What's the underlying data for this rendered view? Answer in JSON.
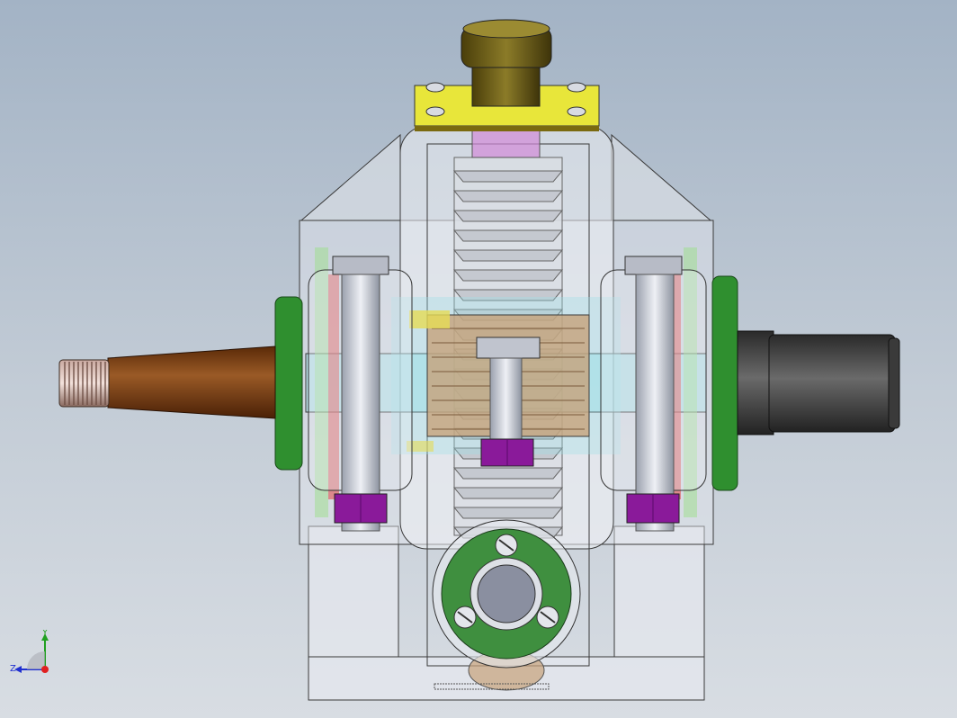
{
  "viewport": {
    "background_top": "#a3b3c5",
    "background_bottom": "#d8dde3"
  },
  "model": {
    "colors": {
      "housing_fill": "#dfe3ea",
      "housing_stroke": "#3a3a3a",
      "cover_plate": "#e8e63a",
      "cap": "#7a6a1e",
      "flange": "#2f8f2f",
      "left_shaft": "#7a3e14",
      "right_shaft": "#4b4b4b",
      "bolt": "#c8ccd6",
      "nut": "#8a1a9a",
      "gear": "#c7a27a",
      "translucent_cyan": "#9fe0e8",
      "end_cover": "#3f8f3f"
    }
  },
  "triad": {
    "x_label": "",
    "y_label": "Y",
    "z_label": "Z",
    "x_color": "#e02020",
    "y_color": "#20a020",
    "z_color": "#2030d0"
  }
}
